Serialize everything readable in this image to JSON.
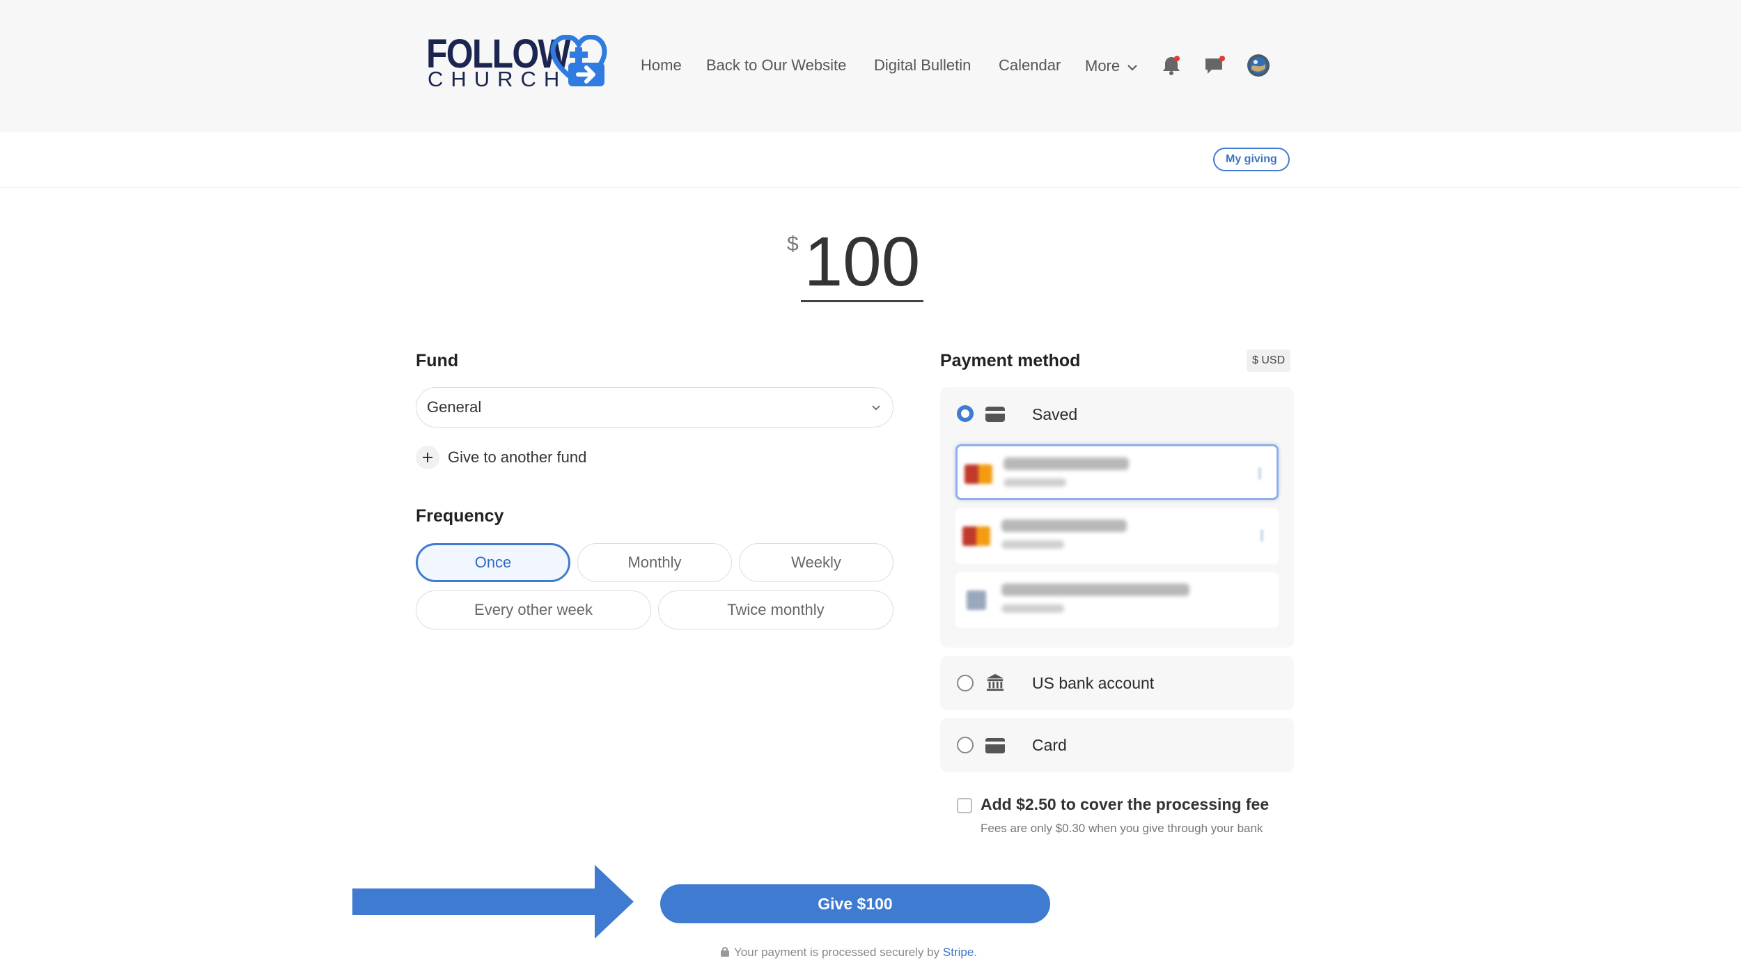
{
  "header": {
    "logo_top": "FOLLOW",
    "logo_bottom": "CHURCH",
    "nav": [
      "Home",
      "Back to Our Website",
      "Digital Bulletin",
      "Calendar",
      "More"
    ],
    "icons": [
      "bell-icon",
      "chat-icon",
      "avatar"
    ],
    "notification_dot_color": "#e53935"
  },
  "subbar": {
    "my_giving": "My giving"
  },
  "amount": {
    "currency_symbol": "$",
    "value": "100"
  },
  "fund": {
    "label": "Fund",
    "selected": "General",
    "add_another": "Give to another fund"
  },
  "frequency": {
    "label": "Frequency",
    "options": [
      "Once",
      "Monthly",
      "Weekly",
      "Every other week",
      "Twice monthly"
    ],
    "selected": "Once"
  },
  "payment": {
    "label": "Payment method",
    "currency_badge": "$ USD",
    "methods": [
      "Saved",
      "US bank account",
      "Card"
    ],
    "selected_method": "Saved"
  },
  "fee": {
    "label": "Add $2.50 to cover the processing fee",
    "note": "Fees are only $0.30 when you give through your bank",
    "checked": false
  },
  "submit": {
    "label": "Give $100"
  },
  "secure": {
    "text": "Your payment is processed securely by",
    "link": "Stripe",
    "end": "."
  },
  "colors": {
    "accent": "#3f7bd0",
    "brand_navy": "#1c2550"
  }
}
